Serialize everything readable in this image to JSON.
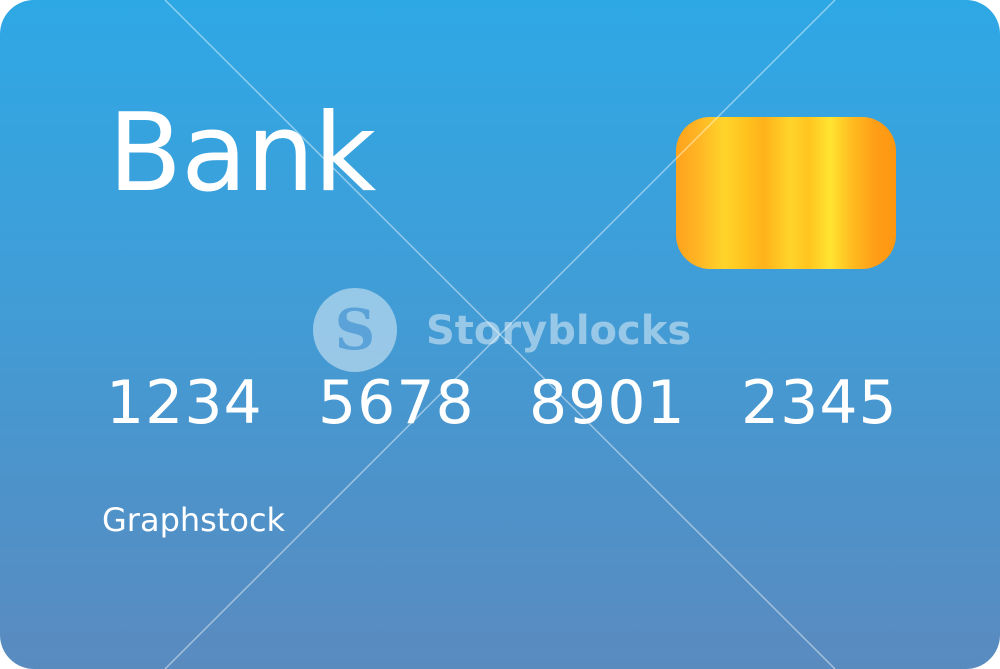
{
  "card": {
    "bank_name": "Bank",
    "number_groups": [
      "1234",
      "5678",
      "8901",
      "2345"
    ],
    "cardholder": "Graphstock"
  },
  "watermark": {
    "text": "Storyblocks",
    "logo_glyph": "S"
  },
  "icons": {
    "chip": "card-chip-icon",
    "watermark_logo": "storyblocks-logo-icon"
  },
  "colors": {
    "card_top": "#2ea8e5",
    "card_bottom": "#5a8bbf",
    "chip_gold": "#ffc21e",
    "text": "#ffffff"
  }
}
